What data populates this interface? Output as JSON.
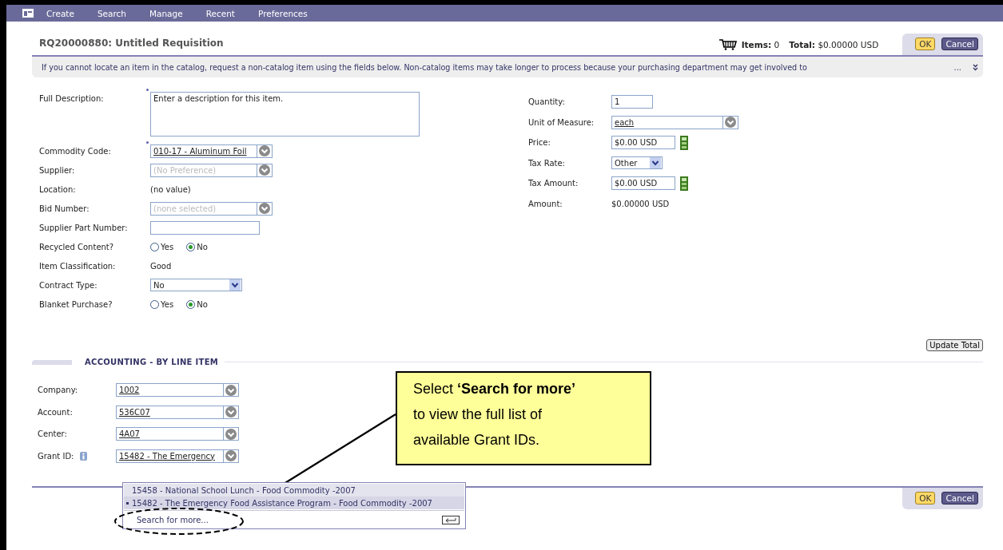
{
  "menu": {
    "items": [
      "Create",
      "Search",
      "Manage",
      "Recent",
      "Preferences"
    ]
  },
  "header": {
    "title": "RQ20000880: Untitled Requisition",
    "items_label": "Items:",
    "items_value": "0",
    "total_label": "Total:",
    "total_value": "$0.00000 USD",
    "buttons": [
      {
        "label": "OK",
        "kind": "primary"
      },
      {
        "label": "Cancel",
        "kind": "secondary"
      }
    ]
  },
  "notice": {
    "text": "If you cannot locate an item in the catalog, request a non-catalog item using the fields below. Non-catalog items may take longer to process because your purchasing department may get involved to",
    "more": "..."
  },
  "left_fields": [
    {
      "label": "Full Description:",
      "kind": "textarea",
      "value": "Enter a description for this item.",
      "required": true
    },
    {
      "label": "Commodity Code:",
      "kind": "combo",
      "value": "010-17 - Aluminum Foil",
      "required": true
    },
    {
      "label": "Supplier:",
      "kind": "combo",
      "placeholder": "(No Preference)"
    },
    {
      "label": "Location:",
      "kind": "static",
      "value": "(no value)"
    },
    {
      "label": "Bid Number:",
      "kind": "combo",
      "placeholder": "(none selected)"
    },
    {
      "label": "Supplier Part Number:",
      "kind": "input"
    },
    {
      "label": "Recycled Content?",
      "kind": "radio",
      "options": [
        {
          "label": "Yes",
          "selected": false
        },
        {
          "label": "No",
          "selected": true
        }
      ]
    },
    {
      "label": "Item Classification:",
      "kind": "static",
      "value": "Good"
    },
    {
      "label": "Contract Type:",
      "kind": "select",
      "value": "No"
    },
    {
      "label": "Blanket Purchase?",
      "kind": "radio",
      "options": [
        {
          "label": "Yes",
          "selected": false
        },
        {
          "label": "No",
          "selected": true
        }
      ]
    }
  ],
  "right_fields": [
    {
      "label": "Quantity:",
      "kind": "input",
      "value": "1"
    },
    {
      "label": "Unit of Measure:",
      "kind": "combo",
      "value": "each"
    },
    {
      "label": "Price:",
      "kind": "money",
      "value": "$0.00 USD"
    },
    {
      "label": "Tax Rate:",
      "kind": "select",
      "value": "Other"
    },
    {
      "label": "Tax Amount:",
      "kind": "money",
      "value": "$0.00 USD"
    },
    {
      "label": "Amount:",
      "kind": "static",
      "value": "$0.00000 USD"
    }
  ],
  "update_total": "Update Total",
  "accounting": {
    "title": "ACCOUNTING - BY LINE ITEM",
    "fields": [
      {
        "label": "Company:",
        "value": "1002",
        "info": false
      },
      {
        "label": "Account:",
        "value": "536C07",
        "info": false
      },
      {
        "label": "Center:",
        "value": "4A07",
        "info": false
      },
      {
        "label": "Grant ID:",
        "value": "15482 - The Emergency",
        "info": true
      }
    ]
  },
  "dropdown": {
    "options": [
      {
        "label": "15458 - National School Lunch - Food Commodity -2007",
        "selected": false
      },
      {
        "label": "15482 - The Emergency Food Assistance Program - Food Commodity -2007",
        "selected": true
      }
    ],
    "search_link": "Search for more..."
  },
  "footer": {
    "buttons": [
      {
        "label": "OK",
        "kind": "primary"
      },
      {
        "label": "Cancel",
        "kind": "secondary"
      }
    ]
  },
  "callout": {
    "text": "Select **‘Search for more’**\nto view the full list of\navailable Grant IDs."
  }
}
